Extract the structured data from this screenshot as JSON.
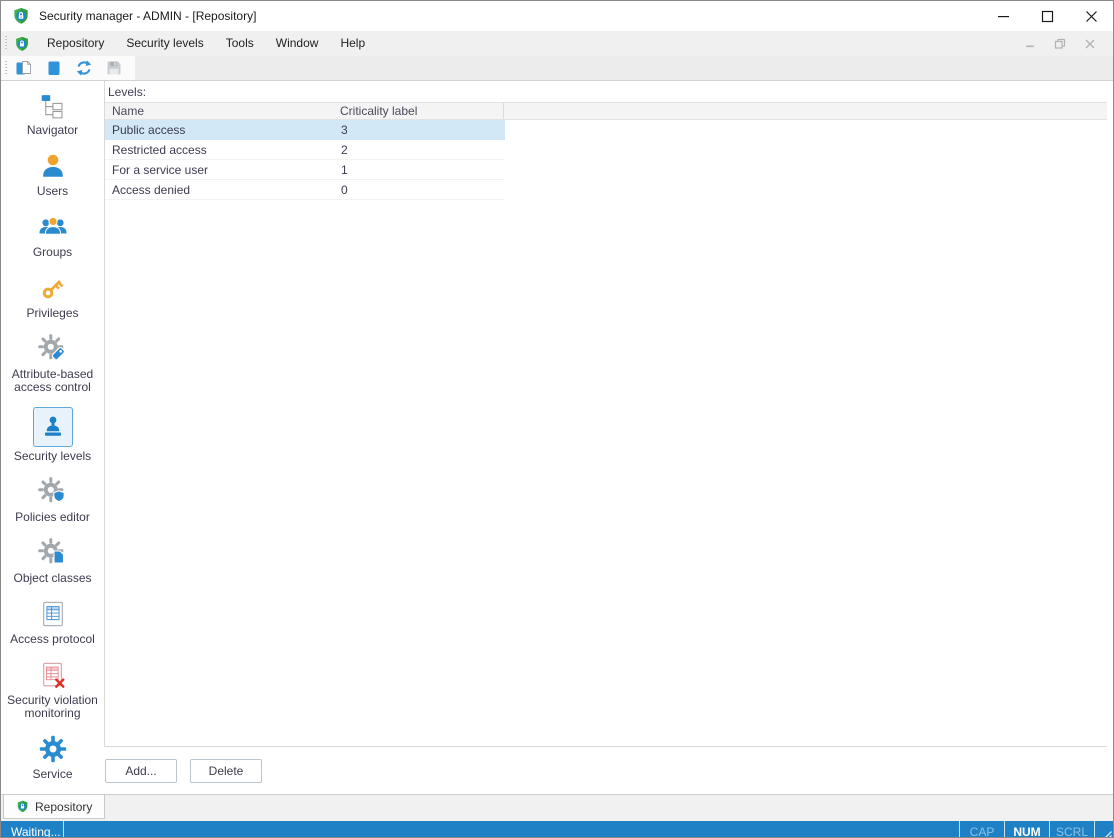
{
  "titlebar": {
    "title": "Security manager - ADMIN - [Repository]"
  },
  "menubar": {
    "items": [
      "Repository",
      "Security levels",
      "Tools",
      "Window",
      "Help"
    ]
  },
  "toolbar": {
    "buttons": [
      {
        "icon": "copy-document-icon",
        "enabled": true
      },
      {
        "icon": "document-icon",
        "enabled": true
      },
      {
        "icon": "refresh-icon",
        "enabled": true
      },
      {
        "icon": "save-icon",
        "enabled": false
      }
    ]
  },
  "sidebar": {
    "items": [
      {
        "label": "Navigator",
        "icon": "navigator-tree-icon",
        "selected": false
      },
      {
        "label": "Users",
        "icon": "user-icon",
        "selected": false
      },
      {
        "label": "Groups",
        "icon": "group-icon",
        "selected": false
      },
      {
        "label": "Privileges",
        "icon": "key-icon",
        "selected": false
      },
      {
        "label": "Attribute-based access control",
        "icon": "gear-tag-icon",
        "selected": false
      },
      {
        "label": "Security levels",
        "icon": "stamp-icon",
        "selected": true
      },
      {
        "label": "Policies editor",
        "icon": "gear-shield-icon",
        "selected": false
      },
      {
        "label": "Object classes",
        "icon": "gear-page-icon",
        "selected": false
      },
      {
        "label": "Access protocol",
        "icon": "table-document-icon",
        "selected": false
      },
      {
        "label": "Security violation monitoring",
        "icon": "table-error-icon",
        "selected": false
      },
      {
        "label": "Service",
        "icon": "gear-icon",
        "selected": false
      }
    ]
  },
  "content": {
    "levels_label": "Levels:",
    "table": {
      "columns": [
        "Name",
        "Criticality label"
      ],
      "rows": [
        [
          "Public access",
          "3"
        ],
        [
          "Restricted access",
          "2"
        ],
        [
          "For a service user",
          "1"
        ],
        [
          "Access denied",
          "0"
        ]
      ],
      "selected_row": 0
    },
    "buttons": {
      "add": "Add...",
      "delete": "Delete"
    }
  },
  "bottom_tabs": {
    "items": [
      {
        "label": "Repository",
        "icon": "shield-lock-icon"
      }
    ]
  },
  "statusbar": {
    "message": "Waiting...",
    "indicators": [
      {
        "label": "CAP",
        "active": false
      },
      {
        "label": "NUM",
        "active": true
      },
      {
        "label": "SCRL",
        "active": false
      }
    ]
  },
  "colors": {
    "accent_blue": "#2B8BD1",
    "statusbar_blue": "#1E81C5",
    "row_highlight": "#D3E8F7",
    "shield_green": "#3CB04D",
    "person_orange": "#F0A42E",
    "key_gold": "#ECAA38",
    "violation_red": "#D93025",
    "gear_gray": "#A2A7AC"
  }
}
